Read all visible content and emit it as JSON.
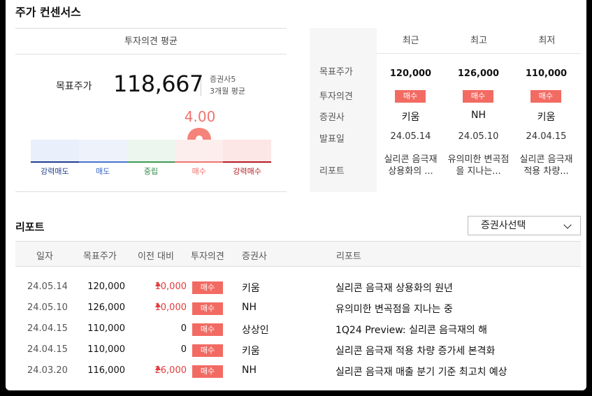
{
  "section_title": "주가 컨센서스",
  "average": {
    "header": "투자의견 평균",
    "target_label": "목표주가",
    "target_value": "118,667",
    "brokers": "증권사5",
    "period": "3개월 평균",
    "score": "4.00",
    "score_value": 4.0,
    "scale_labels": [
      "강력매도",
      "매도",
      "중립",
      "매수",
      "강력매수"
    ],
    "scale_colors": [
      "#e9f0fb",
      "#eef3fb",
      "#ecf6ee",
      "#fdeeee",
      "#fde6e6"
    ],
    "line_colors": [
      "#1f3f8f",
      "#4a73d0",
      "#3f9a55",
      "#f07470",
      "#b31d25"
    ],
    "label_colors": [
      "#1f3f8f",
      "#3a68c8",
      "#2f8a45",
      "#f06a66",
      "#b31d25"
    ]
  },
  "stats": {
    "columns": [
      "최근",
      "최고",
      "최저"
    ],
    "row_labels": [
      "목표주가",
      "투자의견",
      "증권사",
      "발표일",
      "리포트"
    ],
    "items": [
      {
        "price": "120,000",
        "opinion": "매수",
        "broker": "키움",
        "date": "24.05.14",
        "report": "실리콘 음극재 상용화의 ..."
      },
      {
        "price": "126,000",
        "opinion": "매수",
        "broker": "NH",
        "date": "24.05.10",
        "report": "유의미한 변곡점을 지나는..."
      },
      {
        "price": "110,000",
        "opinion": "매수",
        "broker": "키움",
        "date": "24.04.15",
        "report": "실리콘 음극재 적용 차량..."
      }
    ]
  },
  "report": {
    "title": "리포트",
    "select_label": "증권사선택",
    "headers": [
      "일자",
      "목표주가",
      "이전 대비",
      "투자의견",
      "증권사",
      "리포트"
    ],
    "rows": [
      {
        "date": "24.05.14",
        "target": "120,000",
        "change": "10,000",
        "dir": "up",
        "opinion": "매수",
        "broker": "키움",
        "report": "실리콘 음극재 상용화의 원년"
      },
      {
        "date": "24.05.10",
        "target": "126,000",
        "change": "10,000",
        "dir": "up",
        "opinion": "매수",
        "broker": "NH",
        "report": "유의미한 변곡점을 지나는 중"
      },
      {
        "date": "24.04.15",
        "target": "110,000",
        "change": "0",
        "dir": "none",
        "opinion": "매수",
        "broker": "상상인",
        "report": "1Q24 Preview: 실리콘 음극재의 해"
      },
      {
        "date": "24.04.15",
        "target": "110,000",
        "change": "0",
        "dir": "none",
        "opinion": "매수",
        "broker": "키움",
        "report": "실리콘 음극재 적용 차량 증가세 본격화"
      },
      {
        "date": "24.03.20",
        "target": "116,000",
        "change": "26,000",
        "dir": "up",
        "opinion": "매수",
        "broker": "NH",
        "report": "실리콘 음극재 매출 분기 기준 최고치 예상"
      }
    ]
  }
}
